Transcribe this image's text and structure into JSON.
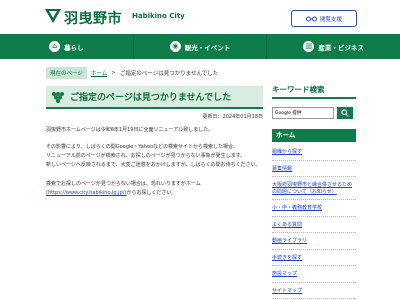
{
  "header": {
    "logo_jp": "羽曳野市",
    "logo_en": "Habikino City",
    "view_button": "閲覧支援",
    "brand_color": "#0e7d49",
    "accent_color": "#2a4fa0"
  },
  "nav": {
    "items": [
      {
        "label": "暮らし",
        "icon": "house-icon"
      },
      {
        "label": "観光・イベント",
        "icon": "camera-icon"
      },
      {
        "label": "産業・ビジネス",
        "icon": "building-icon"
      }
    ]
  },
  "breadcrumb": {
    "current_badge": "現在のページ",
    "home": "ホーム",
    "separator": ">",
    "current": "ご指定のページは見つかりませんでした"
  },
  "main": {
    "title": "ご指定のページは見つかりませんでした",
    "updated": "更新日：2024年01月18日",
    "para1": "羽曳野市ホームページは令和6年1月19日に全面リニューアル致しました。",
    "para2_lines": [
      "その影響により、しばらくの間Google・Yahooなどの検索サイトから検索した場合、",
      "リニューアル前のページが検索され、お探しのページが見つからない事象が発生します。",
      "新しいページへ反映されるまで、大変ご迷惑をおかけしますが、しばらくの間お待ちください。"
    ],
    "para3_line1": "検索でお探しのページが見つからない場合は、恐れいりますがホーム",
    "para3_link": "(https://www.city.habikino.lg.jp/)",
    "para3_tail": "からお探しください。"
  },
  "sidebar": {
    "search_heading": "キーワード検索",
    "search_value": "Google 提供",
    "home_label": "ホーム",
    "links": [
      "組織から探す",
      "募集情報",
      "大阪府羽曳野市と縁合併させるための問題について（お知らせ）",
      "小・中・義務教育学校",
      "よくある質問",
      "動画ライブラリ",
      "手続きを探す",
      "施設マップ",
      "サイトマップ"
    ]
  }
}
